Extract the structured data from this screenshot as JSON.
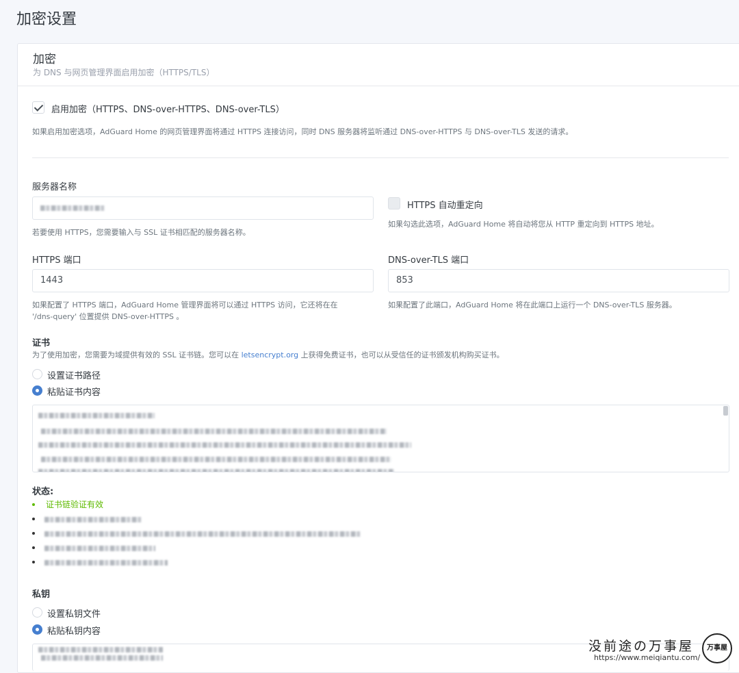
{
  "page": {
    "title": "加密设置"
  },
  "card": {
    "title": "加密",
    "subtitle": "为 DNS 与网页管理界面启用加密（HTTPS/TLS）"
  },
  "enable": {
    "label": "启用加密（HTTPS、DNS-over-HTTPS、DNS-over-TLS）",
    "checked": true,
    "help": "如果启用加密选项，AdGuard Home 的网页管理界面将通过 HTTPS 连接访问，同时 DNS 服务器将监听通过 DNS-over-HTTPS 与 DNS-over-TLS 发送的请求。"
  },
  "server_name": {
    "label": "服务器名称",
    "value": "",
    "help": "若要使用 HTTPS，您需要输入与 SSL 证书相匹配的服务器名称。"
  },
  "https_redirect": {
    "label": "HTTPS 自动重定向",
    "checked": false,
    "help": "如果勾选此选项，AdGuard Home 将自动将您从 HTTP 重定向到 HTTPS 地址。"
  },
  "https_port": {
    "label": "HTTPS 端口",
    "value": "1443",
    "help_line1": "如果配置了 HTTPS 端口，AdGuard Home 管理界面将可以通过 HTTPS 访问，它还将在在",
    "help_line2": "'/dns-query' 位置提供 DNS-over-HTTPS 。"
  },
  "dot_port": {
    "label": "DNS-over-TLS 端口",
    "value": "853",
    "help": "如果配置了此端口，AdGuard Home 将在此端口上运行一个 DNS-over-TLS 服务器。"
  },
  "certificate": {
    "heading": "证书",
    "help_before": "为了使用加密，您需要为域提供有效的 SSL 证书链。您可以在 ",
    "help_link": "letsencrypt.org",
    "help_after": " 上获得免费证书，也可以从受信任的证书颁发机构购买证书。",
    "option_path": "设置证书路径",
    "option_paste": "粘贴证书内容",
    "selected": "paste"
  },
  "status": {
    "heading": "状态:",
    "valid": "证书链验证有效"
  },
  "private_key": {
    "heading": "私钥",
    "option_file": "设置私钥文件",
    "option_paste": "粘贴私钥内容",
    "selected": "paste"
  },
  "watermark": {
    "text": "没前途の万事屋",
    "url": "https://www.meiqiantu.com/",
    "seal": "万事屋"
  },
  "colors": {
    "accent": "#467fcf",
    "success": "#5eba00",
    "background": "#f5f7fb"
  }
}
